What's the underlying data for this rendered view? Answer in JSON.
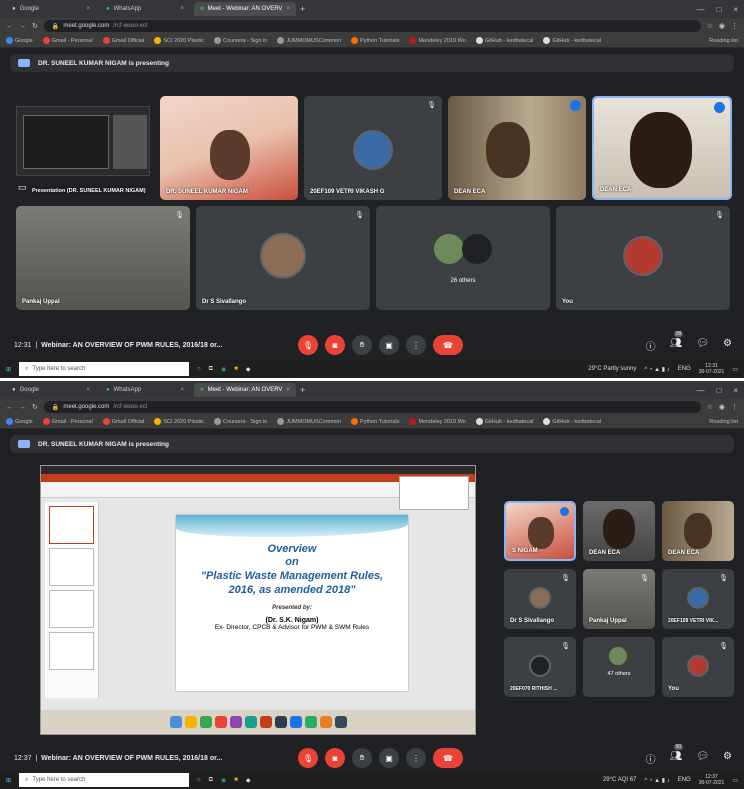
{
  "shot1": {
    "tabs": [
      {
        "label": "Google",
        "active": false
      },
      {
        "label": "WhatsApp",
        "active": false
      },
      {
        "label": "Meet - Webinar: AN OVERV",
        "active": true
      }
    ],
    "url": {
      "host": "meet.google.com",
      "path": "/rcf-wsoo-xcl"
    },
    "bookmarks": [
      "Google",
      "Gmail - Personal",
      "Gmail Official",
      "SCI 2020 Plastic",
      "Coursera - Sign in",
      "JUMMOMUSCommon",
      "Python Tutorials",
      "Mendeley 2019 Wo",
      "GitHub - kedbatecal",
      "GitHub - kedbatecal",
      "Reading list"
    ],
    "presenting_text": "DR. SUNEEL KUMAR NIGAM is presenting",
    "tiles": [
      {
        "name": "Presentation (DR. SUNEEL KUMAR NIGAM)"
      },
      {
        "name": "DR. SUNEEL KUMAR NIGAM"
      },
      {
        "name": "20EF109 VETRI VIKASH G"
      },
      {
        "name": "DEAN ECA"
      },
      {
        "name": "DEAN ECA"
      },
      {
        "name": "Pankaj Uppal"
      },
      {
        "name": "Dr S Sivallango"
      },
      {
        "name": "26 others"
      },
      {
        "name": "You"
      }
    ],
    "time": "12:31",
    "meeting_title": "Webinar: AN OVERVIEW OF PWM RULES, 2016/18 or...",
    "participants_badge": "28",
    "taskbar": {
      "search_placeholder": "Type here to search",
      "weather": "29°C Partly sunny",
      "lang": "ENG",
      "clock_time": "12:31",
      "clock_date": "30-07-2021"
    }
  },
  "shot2": {
    "tabs": [
      {
        "label": "Google",
        "active": false
      },
      {
        "label": "WhatsApp",
        "active": false
      },
      {
        "label": "Meet - Webinar: AN OVERV",
        "active": true
      }
    ],
    "url": {
      "host": "meet.google.com",
      "path": "/rcf-wsoo-xcl"
    },
    "bookmarks": [
      "Google",
      "Gmail - Personal",
      "Gmail Official",
      "SCI 2020 Plastic",
      "Coursera - Sign in",
      "JUMMOMUSCommon",
      "Python Tutorials",
      "Mendeley 2019 Wo",
      "GitHub - kedbatecal",
      "GitHub - kedbatecal",
      "Reading list"
    ],
    "presenting_text": "DR. SUNEEL KUMAR NIGAM is presenting",
    "slide": {
      "line1": "Overview",
      "line2": "on",
      "line3": "\"Plastic Waste Management Rules,",
      "line4": "2016, as amended 2018\"",
      "presented_by": "Presented by:",
      "author": "(Dr. S.K. Nigam)",
      "designation": "Ex- Director, CPCB & Advisor for PWM & SWM Rules"
    },
    "tiles": [
      {
        "name": "S NIGAM"
      },
      {
        "name": "DEAN ECA"
      },
      {
        "name": "DEAN ECA"
      },
      {
        "name": "Dr S Sivallango"
      },
      {
        "name": "Pankaj Uppal"
      },
      {
        "name": "20EF109 VETRI VIK..."
      },
      {
        "name": "20EF070 RITHISH ..."
      },
      {
        "name": "47 others"
      },
      {
        "name": "You"
      }
    ],
    "time": "12:37",
    "meeting_title": "Webinar: AN OVERVIEW OF PWM RULES, 2016/18 or...",
    "participants_badge": "50",
    "taskbar": {
      "search_placeholder": "Type here to search",
      "weather": "29°C AQI 67",
      "lang": "ENG",
      "clock_time": "12:37",
      "clock_date": "30-07-2021"
    }
  },
  "colors": {
    "meet_bg": "#202124",
    "tile_bg": "#3c4043",
    "end_call": "#ea4335",
    "speaking": "#1a73e8"
  }
}
